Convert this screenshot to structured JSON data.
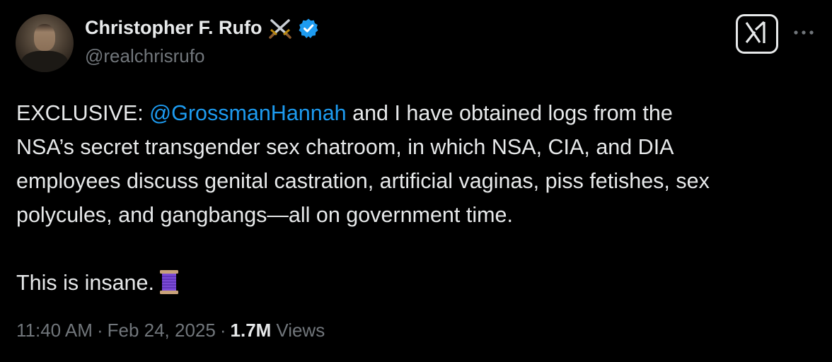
{
  "author": {
    "display_name": "Christopher F. Rufo",
    "handle": "@realchrisrufo",
    "name_emoji": "crossed-swords",
    "verified": true,
    "verified_color": "#1d9bf0"
  },
  "header_actions": {
    "grok_icon": "grok-icon",
    "more_icon": "more-horizontal-icon"
  },
  "tweet": {
    "lines": [
      {
        "prefix": "EXCLUSIVE: ",
        "mention": "@GrossmanHannah",
        "suffix": " and I have obtained logs from the"
      },
      {
        "text": "NSA’s secret transgender sex chatroom, in which NSA, CIA, and DIA"
      },
      {
        "text": "employees discuss genital castration, artificial vaginas, piss fetishes, sex"
      },
      {
        "text": "polycules, and gangbangs—all on government time."
      },
      {
        "text": "This is insane."
      }
    ],
    "end_emoji": "thread-spool",
    "mention_color": "#1d9bf0"
  },
  "meta": {
    "time": "11:40 AM",
    "date": "Feb 24, 2025",
    "separator": "·",
    "views_count": "1.7M",
    "views_label": "Views"
  },
  "colors": {
    "background": "#000000",
    "text": "#e7e9ea",
    "secondary_text": "#71767b",
    "accent": "#1d9bf0"
  }
}
